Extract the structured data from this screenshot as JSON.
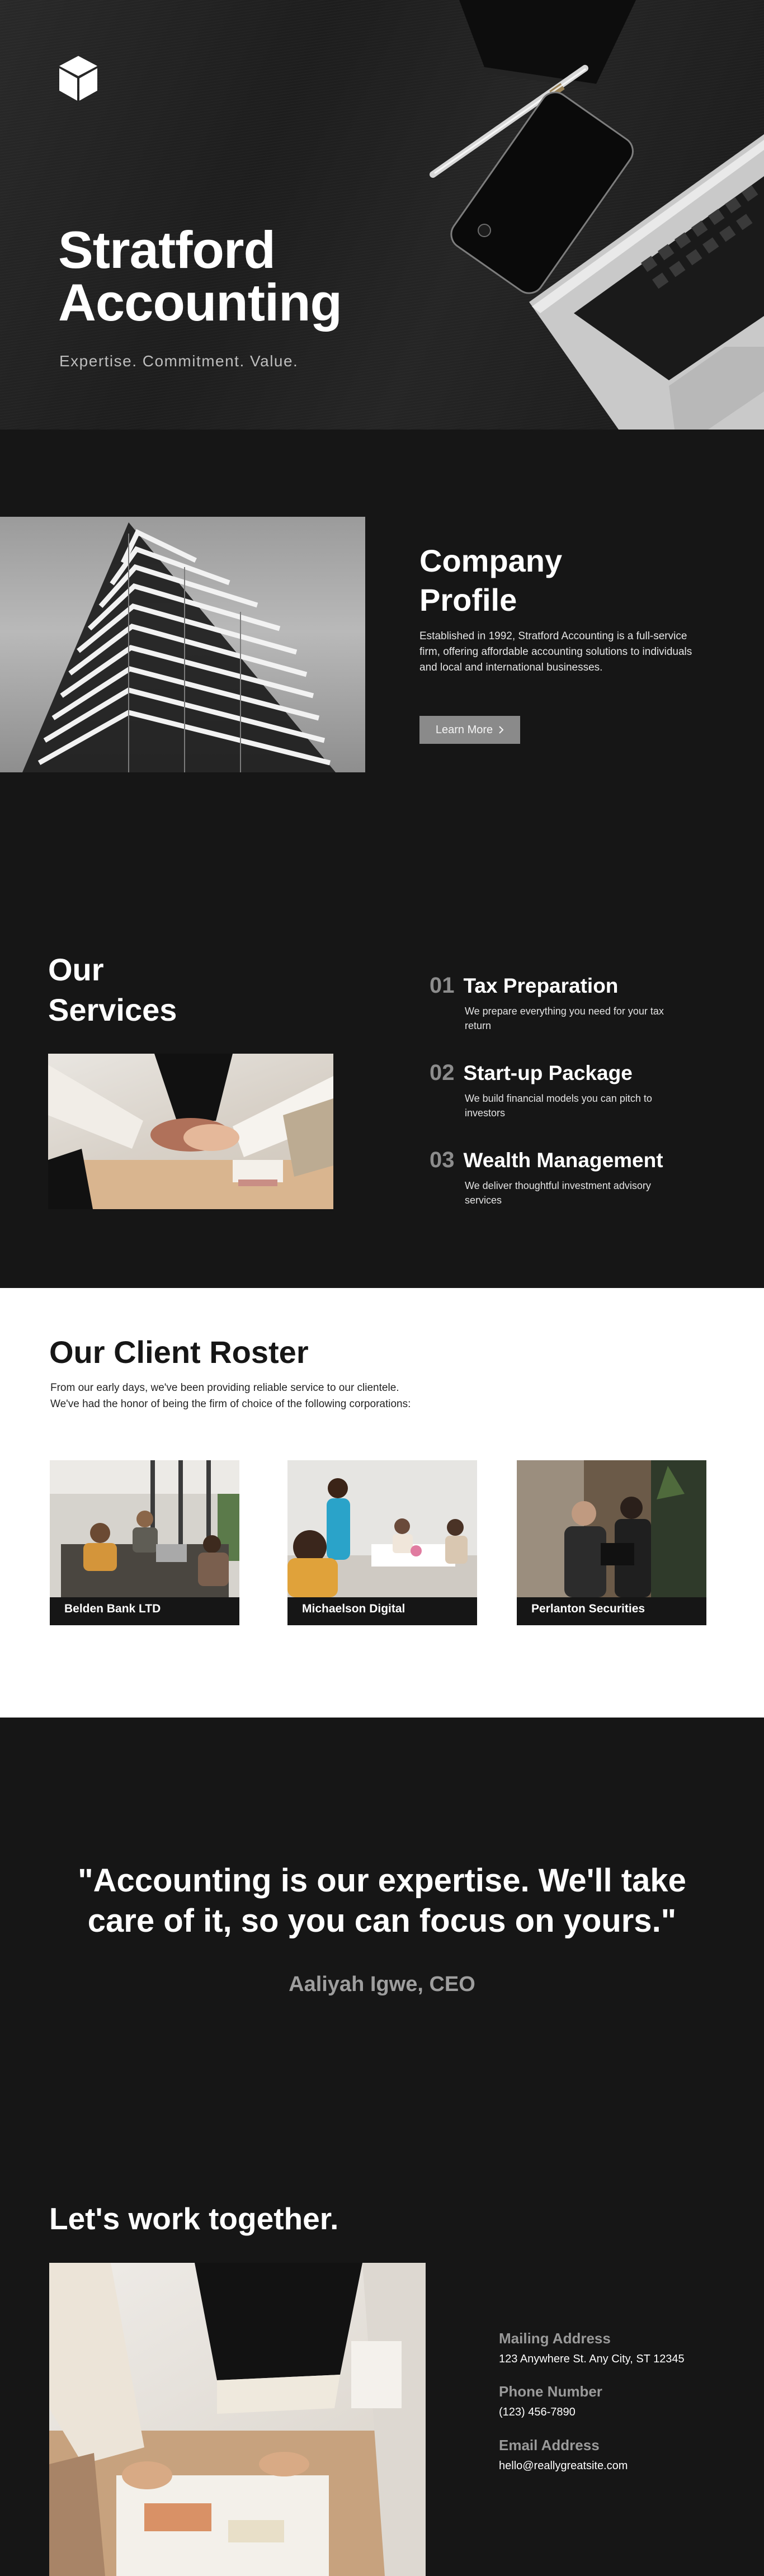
{
  "hero": {
    "title_line1": "Stratford",
    "title_line2": "Accounting",
    "tagline": "Expertise. Commitment. Value.",
    "logo_icon": "cube-icon"
  },
  "profile": {
    "title_line1": "Company",
    "title_line2": "Profile",
    "text": "Established in 1992, Stratford Accounting is a full-service firm, offering affordable accounting solutions to individuals and local and international businesses.",
    "button_label": "Learn More",
    "button_icon": "chevron-right-icon"
  },
  "services": {
    "title_line1": "Our",
    "title_line2": "Services",
    "items": [
      {
        "number": "01",
        "name": "Tax Preparation",
        "description": "We prepare everything you need for your tax return"
      },
      {
        "number": "02",
        "name": "Start-up Package",
        "description": "We build financial models you can pitch to investors"
      },
      {
        "number": "03",
        "name": "Wealth Management",
        "description": "We deliver thoughtful investment advisory services"
      }
    ]
  },
  "roster": {
    "title": "Our Client Roster",
    "intro_line1": "From our early days, we've been providing reliable service to our clientele.",
    "intro_line2": "We've had the honor of being the firm of choice of the following corporations:",
    "clients": [
      {
        "name": "Belden Bank LTD"
      },
      {
        "name": "Michaelson Digital"
      },
      {
        "name": "Perlanton Securities"
      }
    ]
  },
  "quote": {
    "text": "\"Accounting is our expertise. We'll take care of it, so you can focus on yours.\"",
    "author": "Aaliyah Igwe, CEO"
  },
  "contact": {
    "title": "Let's work together.",
    "mailing_label": "Mailing Address",
    "mailing_value": "123 Anywhere St. Any City, ST 12345",
    "phone_label": "Phone Number",
    "phone_value": "(123) 456-7890",
    "email_label": "Email Address",
    "email_value": "hello@reallygreatsite.com"
  },
  "colors": {
    "background": "#161616",
    "accent_gray": "#8a8a8a",
    "muted_text": "#9e9e9e",
    "roster_bg": "#ffffff"
  }
}
